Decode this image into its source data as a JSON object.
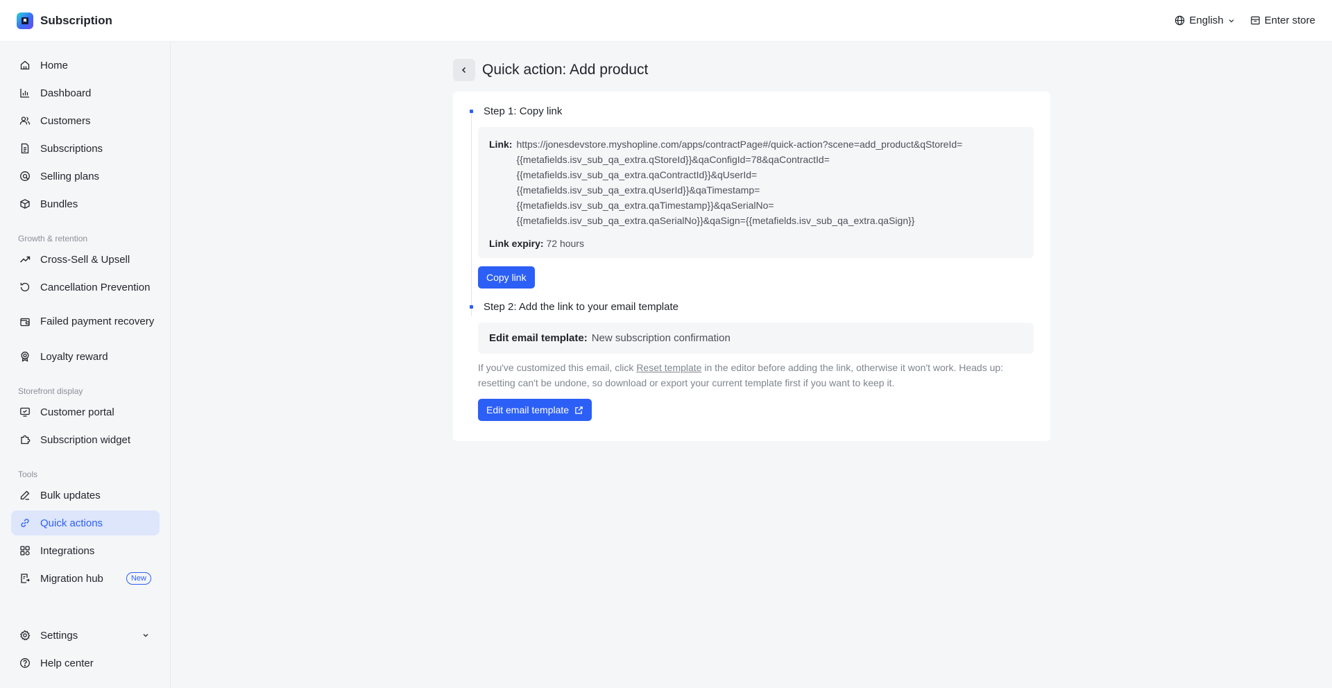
{
  "app": {
    "title": "Subscription",
    "brand_color": "#2c5ff6"
  },
  "topbar": {
    "language": "English",
    "enter_store": "Enter store"
  },
  "sidebar": {
    "main_items": [
      {
        "label": "Home",
        "icon": "home-icon"
      },
      {
        "label": "Dashboard",
        "icon": "bar-chart-icon"
      },
      {
        "label": "Customers",
        "icon": "users-icon"
      },
      {
        "label": "Subscriptions",
        "icon": "document-icon"
      },
      {
        "label": "Selling plans",
        "icon": "tag-icon"
      },
      {
        "label": "Bundles",
        "icon": "box-icon"
      }
    ],
    "growth_title": "Growth & retention",
    "growth_items": [
      {
        "label": "Cross-Sell & Upsell",
        "icon": "trending-up-icon"
      },
      {
        "label": "Cancellation Prevention",
        "icon": "refresh-icon"
      },
      {
        "label": "Failed payment recovery",
        "icon": "wallet-icon"
      },
      {
        "label": "Loyalty reward",
        "icon": "award-icon"
      }
    ],
    "storefront_title": "Storefront display",
    "storefront_items": [
      {
        "label": "Customer portal",
        "icon": "monitor-icon"
      },
      {
        "label": "Subscription widget",
        "icon": "puzzle-icon"
      }
    ],
    "tools_title": "Tools",
    "tools_items": [
      {
        "label": "Bulk updates",
        "icon": "pen-icon"
      },
      {
        "label": "Quick actions",
        "icon": "link-icon",
        "active": true
      },
      {
        "label": "Integrations",
        "icon": "grid-icon"
      },
      {
        "label": "Migration hub",
        "icon": "migrate-icon",
        "badge": "New"
      }
    ],
    "settings": "Settings",
    "help": "Help center"
  },
  "page": {
    "title": "Quick action: Add product",
    "step1": {
      "title": "Step 1: Copy link",
      "link_label": "Link:",
      "link_lines": [
        "https://jonesdevstore.myshopline.com/apps/contractPage#/quick-action?scene=add_product&qStoreId=",
        "{{metafields.isv_sub_qa_extra.qStoreId}}&qaConfigId=78&qaContractId=",
        "{{metafields.isv_sub_qa_extra.qaContractId}}&qUserId=",
        "{{metafields.isv_sub_qa_extra.qUserId}}&qaTimestamp=",
        "{{metafields.isv_sub_qa_extra.qaTimestamp}}&qaSerialNo=",
        "{{metafields.isv_sub_qa_extra.qaSerialNo}}&qaSign={{metafields.isv_sub_qa_extra.qaSign}}"
      ],
      "expiry_label": "Link expiry:",
      "expiry_value": "72 hours",
      "copy_button": "Copy link"
    },
    "step2": {
      "title": "Step 2: Add the link to your email template",
      "template_label": "Edit email template:",
      "template_value": "New subscription confirmation",
      "note_before": "If you've customized this email, click ",
      "note_link": "Reset template",
      "note_after": " in the editor before adding the link, otherwise it won't work. Heads up: resetting can't be undone, so download or export your current template first if you want to keep it.",
      "edit_button": "Edit email template"
    }
  }
}
